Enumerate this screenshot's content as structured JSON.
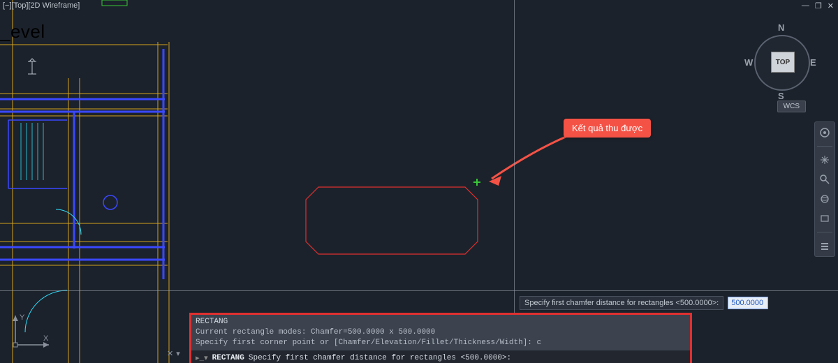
{
  "view_label": "[−][Top][2D Wireframe]",
  "level_text": "_evel",
  "window_controls": {
    "min": "—",
    "restore": "❐",
    "close": "✕"
  },
  "callout": {
    "text": "Kết quả thu được"
  },
  "viewcube": {
    "face": "TOP",
    "n": "N",
    "e": "E",
    "s": "S",
    "w": "W",
    "wcs": "WCS"
  },
  "prompt": {
    "label": "Specify first chamfer distance for rectangles <500.0000>:",
    "value": "500.0000"
  },
  "cmd": {
    "l1": "RECTANG",
    "l2": "Current rectangle modes:  Chamfer=500.0000 x 500.0000",
    "l3": "Specify first corner point or [Chamfer/Elevation/Fillet/Thickness/Width]: c",
    "active_cmd": "RECTANG",
    "active_rest": "Specify first chamfer distance for rectangles <500.0000>:"
  },
  "ucs": {
    "x": "X",
    "y": "Y"
  },
  "cmd_icons": {
    "a": "✕",
    "b": "▾"
  }
}
